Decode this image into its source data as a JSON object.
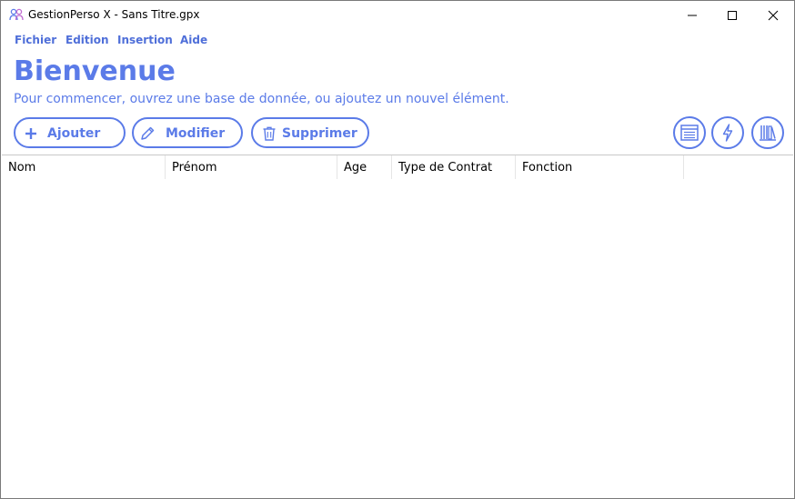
{
  "window": {
    "title": "GestionPerso X - Sans Titre.gpx",
    "controls": [
      "minimize-icon",
      "maximize-icon",
      "close-icon"
    ]
  },
  "menu": {
    "items": [
      {
        "label": "Fichier"
      },
      {
        "label": "Edition"
      },
      {
        "label": "Insertion"
      },
      {
        "label": "Aide"
      }
    ]
  },
  "header": {
    "title": "Bienvenue",
    "subtitle": "Pour commencer, ouvrez une base de donnée, ou ajoutez un nouvel élément."
  },
  "toolbar": {
    "add_label": "Ajouter",
    "edit_label": "Modifier",
    "delete_label": "Supprimer",
    "add_icon": "plus-icon",
    "edit_icon": "pencil-icon",
    "delete_icon": "trash-icon",
    "right_buttons": [
      "list-view-icon",
      "lightning-icon",
      "library-icon"
    ]
  },
  "table": {
    "columns": [
      "Nom",
      "Prénom",
      "Age",
      "Type de Contrat",
      "Fonction"
    ],
    "rows": []
  },
  "colors": {
    "accent": "#5b7be8",
    "menu": "#4f6fd9"
  }
}
